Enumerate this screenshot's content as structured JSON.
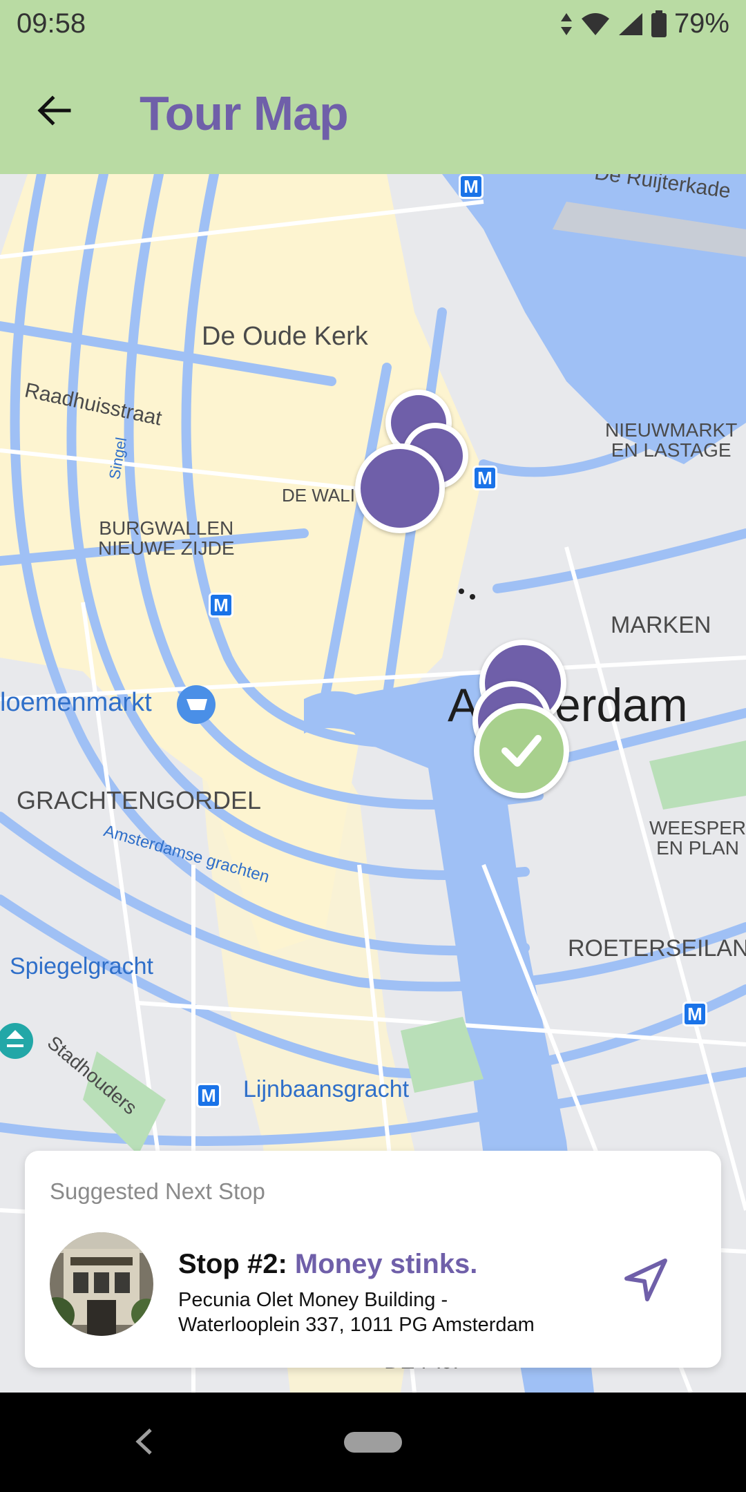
{
  "status": {
    "time": "09:58",
    "battery": "79%"
  },
  "app_bar": {
    "title": "Tour Map",
    "back_icon": "arrow-back-icon"
  },
  "map": {
    "labels": {
      "ruijterkade": "De Ruijterkade",
      "oude_kerk": "De Oude Kerk",
      "raadhuisstraat": "Raadhuisstraat",
      "singel": "Singel",
      "de_wallen": "DE WALI",
      "burgwallen": "BURGWALLEN\nNIEUWE ZIJDE",
      "nieuwmarkt": "NIEUWMARKT\nEN LASTAGE",
      "marken": "MARKEN",
      "bloemenmarkt": "loemenmarkt",
      "amsterdam": "Amsterdam",
      "grachtengordel": "GRACHTENGORDEL",
      "grachten": "Amsterdamse grachten",
      "weesper": "WEESPER\nEN PLAN",
      "roeterseiland": "ROETERSEILAN",
      "spiegelgracht": "Spiegelgracht",
      "stadhouders": "Stadhouders",
      "lijnbaansgracht": "Lijnbaansgracht",
      "de_pijp": "DE PIJP"
    },
    "metro_badge": "M"
  },
  "card": {
    "header": "Suggested Next Stop",
    "stop_prefix": "Stop #2: ",
    "stop_name": "Money stinks.",
    "address_line1": "Pecunia Olet Money Building -",
    "address_line2": "Waterlooplein 337, 1011 PG Amsterdam",
    "nav_icon": "navigation-arrow-icon"
  },
  "colors": {
    "app_bar": "#b9dba3",
    "accent": "#6f5fa9",
    "visited": "#a8d08d",
    "water": "#9fc0f5",
    "land": "#e8e9ec",
    "highlight": "#fdf4d0"
  }
}
